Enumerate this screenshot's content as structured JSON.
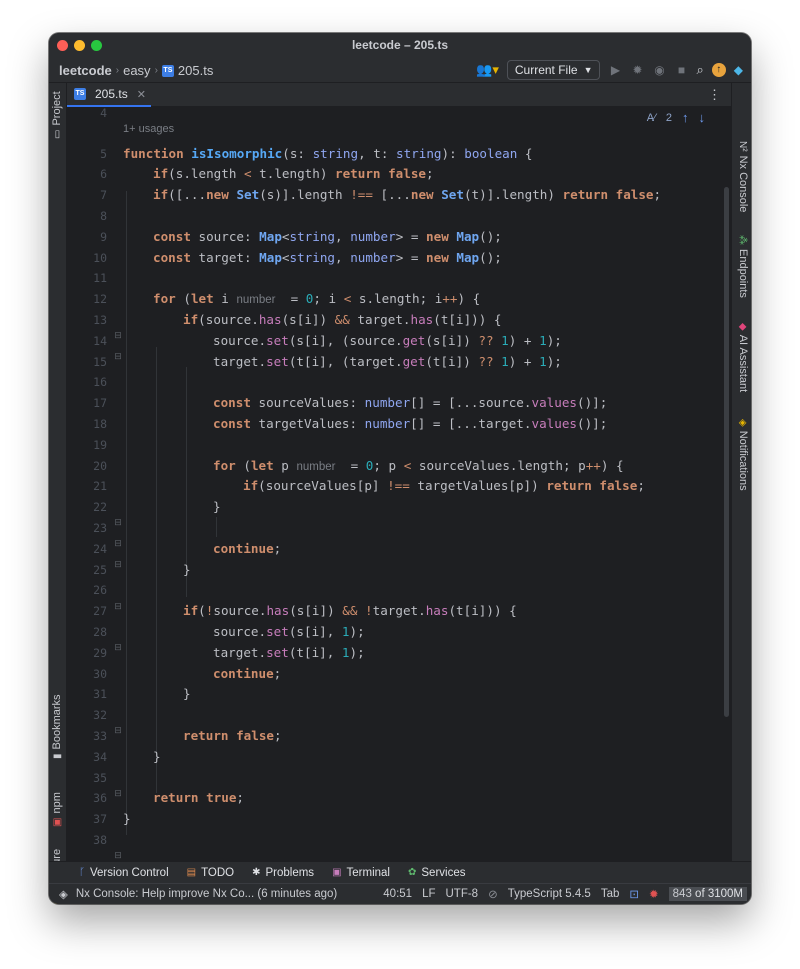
{
  "window": {
    "title": "leetcode – 205.ts"
  },
  "breadcrumb": {
    "project": "leetcode",
    "folder": "easy",
    "file": "205.ts",
    "file_badge": "TS"
  },
  "toolbar": {
    "run_config": "Current File"
  },
  "tabs": [
    {
      "label": "205.ts",
      "badge": "TS"
    }
  ],
  "left_tools": {
    "project": "Project",
    "bookmarks": "Bookmarks",
    "npm": "npm",
    "structure": "Structure"
  },
  "right_tools": {
    "nx": "Nx Console",
    "endpoints": "Endpoints",
    "ai": "AI Assistant",
    "notifications": "Notifications"
  },
  "editor": {
    "usages_hint": "1+ usages",
    "inspection_count": "2",
    "inlay_hint_type": "number",
    "line_numbers": [
      "4",
      "5",
      "6",
      "7",
      "8",
      "9",
      "10",
      "11",
      "12",
      "13",
      "14",
      "15",
      "16",
      "17",
      "18",
      "19",
      "20",
      "21",
      "22",
      "23",
      "24",
      "25",
      "26",
      "27",
      "28",
      "29",
      "30",
      "31",
      "32",
      "33",
      "34",
      "35",
      "36",
      "37",
      "38"
    ]
  },
  "bottom_tools": [
    {
      "label": "Version Control",
      "icon": "branch-icon"
    },
    {
      "label": "TODO",
      "icon": "todo-icon"
    },
    {
      "label": "Problems",
      "icon": "bug-icon"
    },
    {
      "label": "Terminal",
      "icon": "terminal-icon"
    },
    {
      "label": "Services",
      "icon": "services-icon"
    }
  ],
  "status": {
    "message": "Nx Console: Help improve Nx Co... (6 minutes ago)",
    "position": "40:51",
    "line_ending": "LF",
    "encoding": "UTF-8",
    "language": "TypeScript 5.4.5",
    "indent": "Tab",
    "memory_used": "843",
    "memory_of": "of 3100M"
  },
  "colors": {
    "keyword": "#cf8e6d",
    "function": "#56a8f5",
    "type": "#8fa6f0",
    "method": "#c77dbb",
    "number": "#2aacb8",
    "accent": "#3574f0"
  }
}
